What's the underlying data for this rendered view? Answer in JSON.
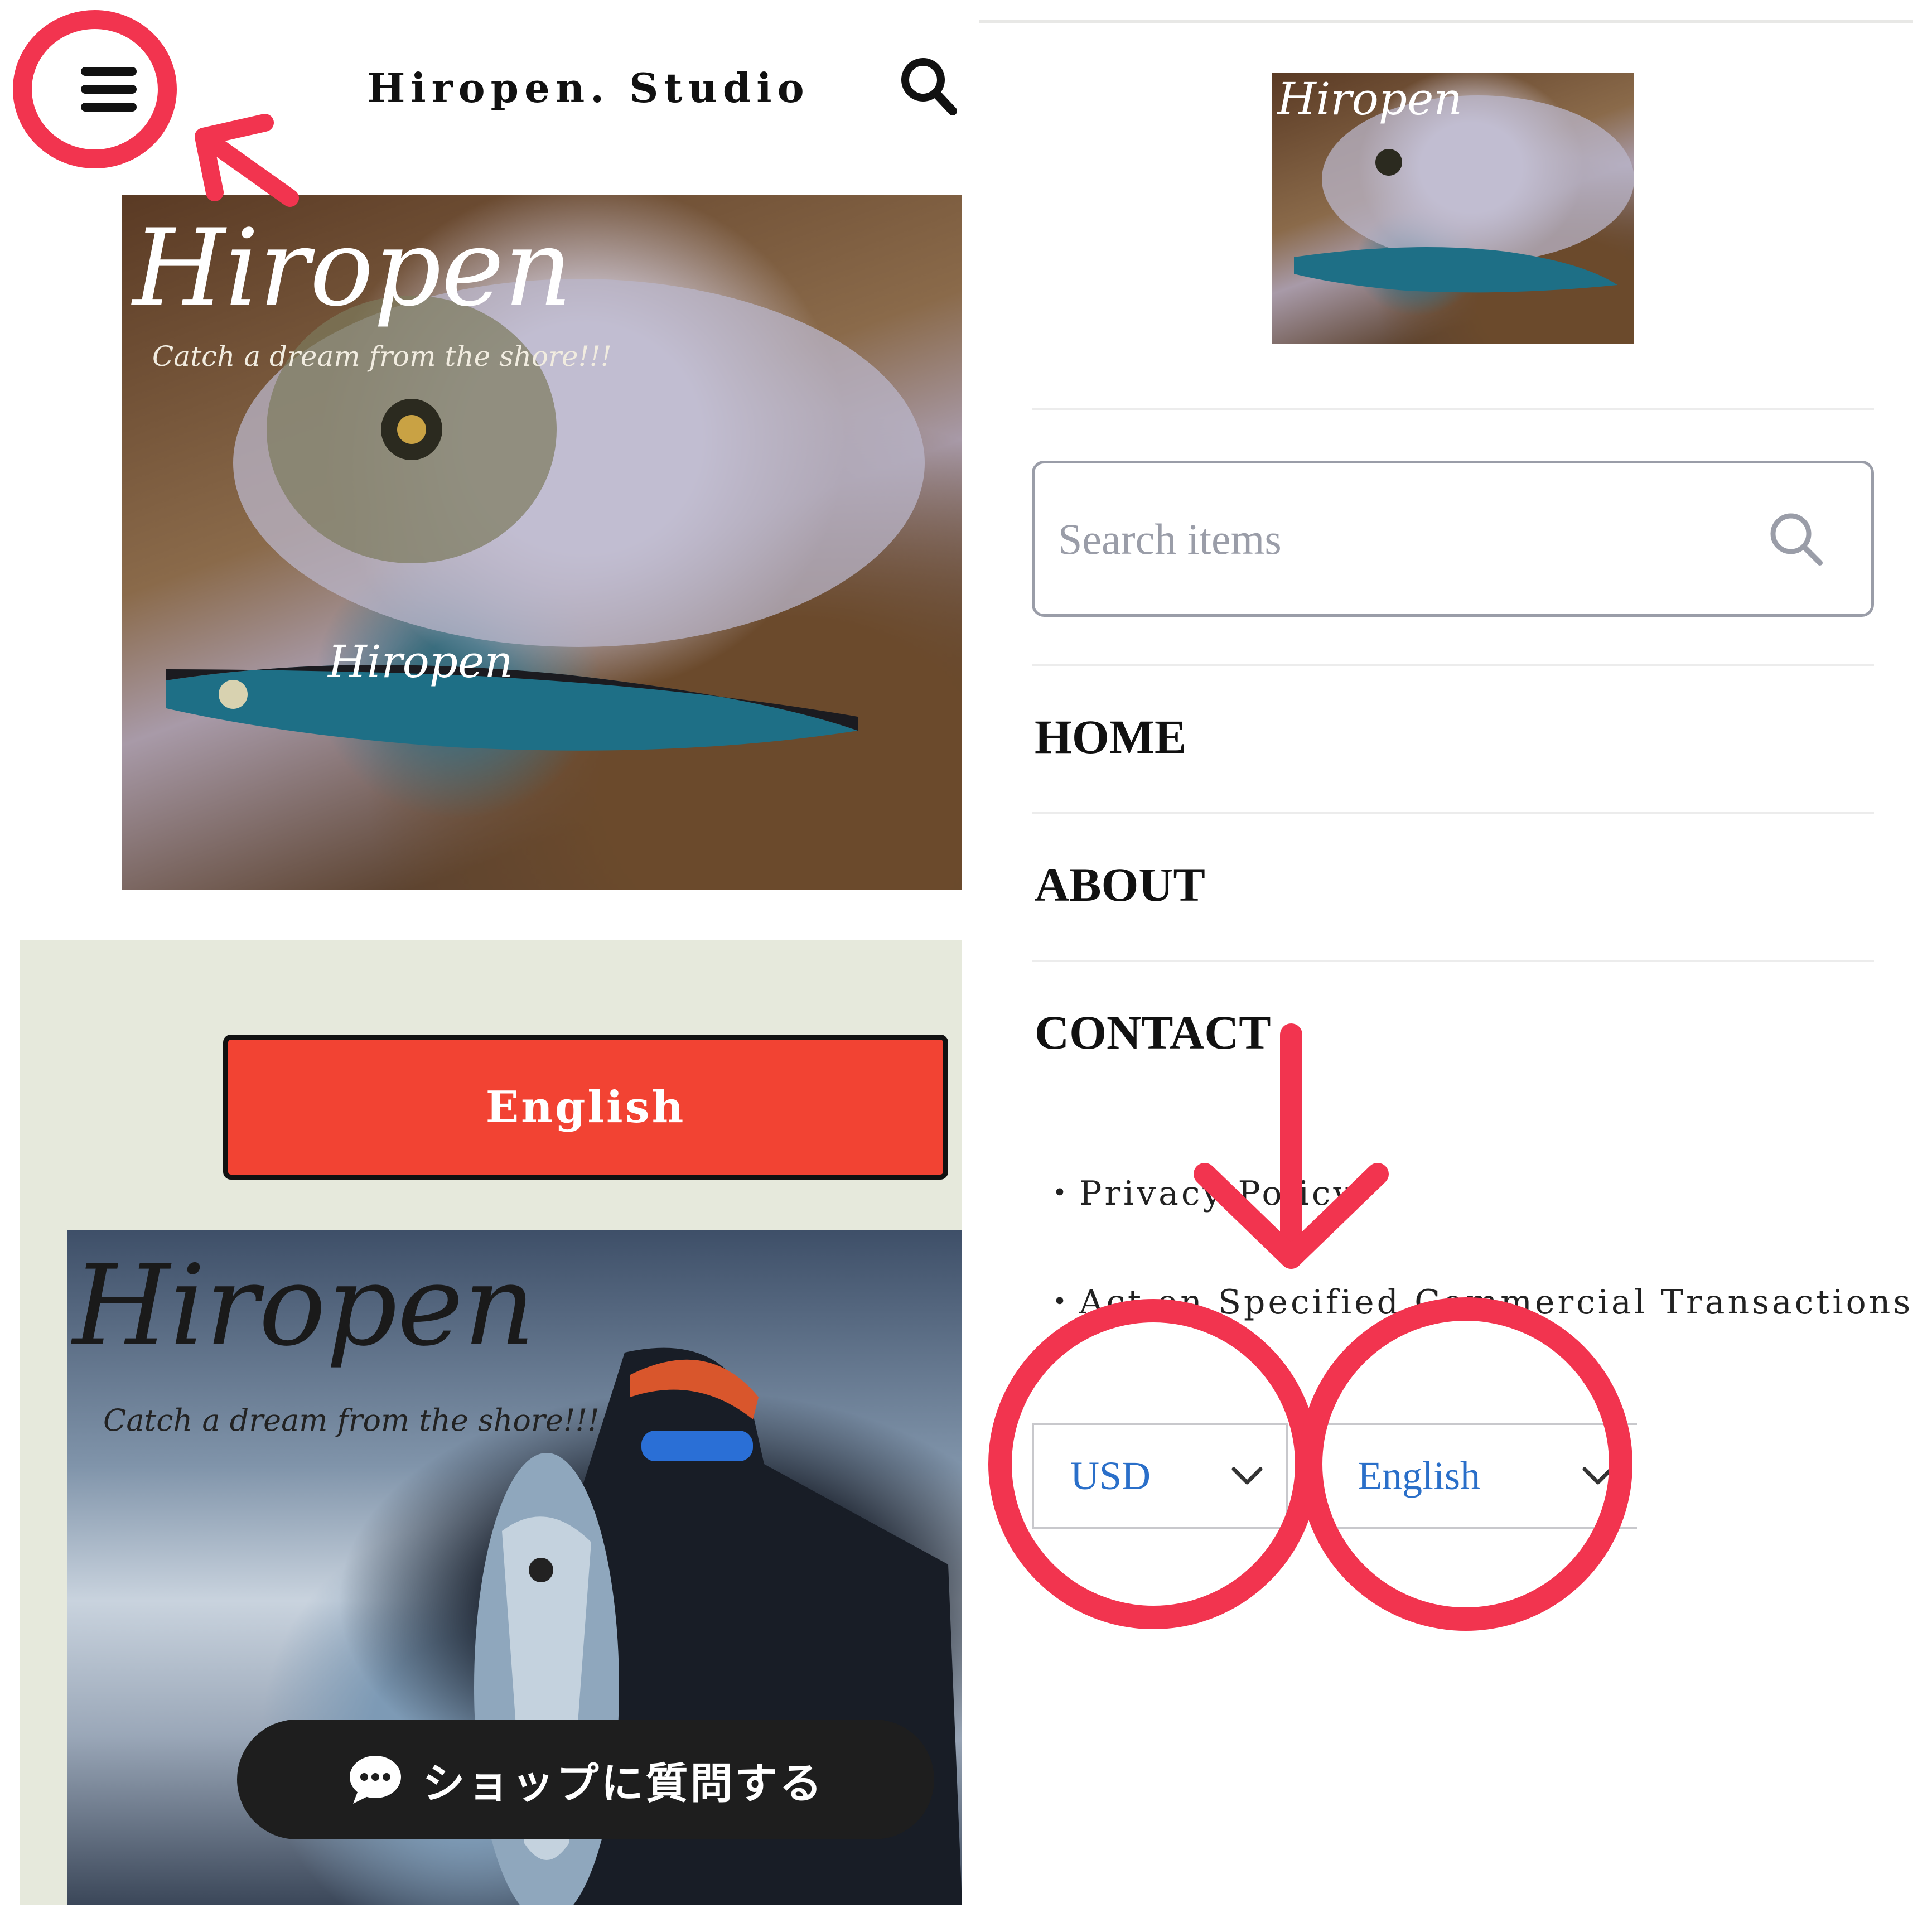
{
  "left": {
    "header": {
      "title": "Hiropen. Studio",
      "menu_icon": "hamburger-menu-icon",
      "search_icon": "search-icon"
    },
    "hero": {
      "logo": "Hiropen",
      "tagline": "Catch a dream from the shore!!!",
      "lure_brand": "Hiropen"
    },
    "language_banner": "English",
    "promo": {
      "logo": "Hiropen",
      "tagline": "Catch a dream from the shore!!!"
    },
    "chat": {
      "label": "ショップに質問する",
      "icon": "chat-bubble-icon"
    }
  },
  "drawer": {
    "logo": "Hiropen",
    "search": {
      "placeholder": "Search items",
      "icon": "search-icon"
    },
    "nav": [
      "HOME",
      "ABOUT",
      "CONTACT"
    ],
    "links": [
      "・Privacy Policy",
      "・Act on Specified Commercial Transactions"
    ],
    "currency": {
      "selected": "USD",
      "icon": "chevron-down-icon"
    },
    "language": {
      "selected": "English",
      "icon": "chevron-down-icon"
    }
  },
  "annotation_color": "#f2344f"
}
